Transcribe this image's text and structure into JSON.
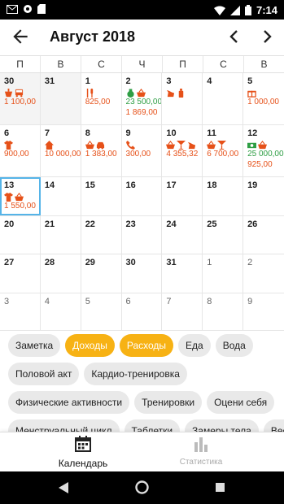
{
  "status": {
    "time": "7:14"
  },
  "toolbar": {
    "title": "Август 2018"
  },
  "weekdays": [
    "П",
    "В",
    "С",
    "Ч",
    "П",
    "С",
    "В"
  ],
  "weeks": [
    [
      {
        "d": "30",
        "out": true,
        "icons": [
          "food-icon",
          "bus-icon"
        ],
        "amounts": [
          {
            "t": "1 100,00",
            "k": "exp"
          }
        ]
      },
      {
        "d": "31",
        "out": true,
        "icons": [],
        "amounts": []
      },
      {
        "d": "1",
        "icons": [
          "restaurant-icon"
        ],
        "amounts": [
          {
            "t": "825,00",
            "k": "exp"
          }
        ]
      },
      {
        "d": "2",
        "icons": [
          "money-bag-icon",
          "basket-icon"
        ],
        "amounts": [
          {
            "t": "23 500,00",
            "k": "inc"
          },
          {
            "t": "1 869,00",
            "k": "exp"
          }
        ]
      },
      {
        "d": "3",
        "icons": [
          "pet-icon",
          "bottle-icon"
        ],
        "amounts": []
      },
      {
        "d": "4",
        "icons": [],
        "amounts": []
      },
      {
        "d": "5",
        "icons": [
          "gift-icon"
        ],
        "amounts": [
          {
            "t": "1 000,00",
            "k": "exp"
          }
        ]
      }
    ],
    [
      {
        "d": "6",
        "icons": [
          "shirt-icon"
        ],
        "amounts": [
          {
            "t": "900,00",
            "k": "exp"
          }
        ]
      },
      {
        "d": "7",
        "icons": [
          "home-icon"
        ],
        "amounts": [
          {
            "t": "10 000,00",
            "k": "exp"
          }
        ]
      },
      {
        "d": "8",
        "icons": [
          "basket-icon",
          "car-icon"
        ],
        "amounts": [
          {
            "t": "1 383,00",
            "k": "exp"
          }
        ]
      },
      {
        "d": "9",
        "icons": [
          "phone-icon"
        ],
        "amounts": [
          {
            "t": "300,00",
            "k": "exp"
          }
        ]
      },
      {
        "d": "10",
        "icons": [
          "basket-icon",
          "cocktail-icon",
          "pet-icon"
        ],
        "amounts": [
          {
            "t": "4 355,32",
            "k": "exp"
          }
        ]
      },
      {
        "d": "11",
        "icons": [
          "basket-icon",
          "cocktail-icon"
        ],
        "amounts": [
          {
            "t": "6 700,00",
            "k": "exp"
          }
        ]
      },
      {
        "d": "12",
        "icons": [
          "cash-icon",
          "basket-icon"
        ],
        "amounts": [
          {
            "t": "25 000,00",
            "k": "inc"
          },
          {
            "t": "925,00",
            "k": "exp"
          }
        ]
      }
    ],
    [
      {
        "d": "13",
        "today": true,
        "icons": [
          "shirt-icon",
          "basket-icon"
        ],
        "amounts": [
          {
            "t": "1 550,00",
            "k": "exp"
          }
        ]
      },
      {
        "d": "14",
        "icons": [],
        "amounts": []
      },
      {
        "d": "15",
        "icons": [],
        "amounts": []
      },
      {
        "d": "16",
        "icons": [],
        "amounts": []
      },
      {
        "d": "17",
        "icons": [],
        "amounts": []
      },
      {
        "d": "18",
        "icons": [],
        "amounts": []
      },
      {
        "d": "19",
        "icons": [],
        "amounts": []
      }
    ],
    [
      {
        "d": "20",
        "icons": [],
        "amounts": []
      },
      {
        "d": "21",
        "icons": [],
        "amounts": []
      },
      {
        "d": "22",
        "icons": [],
        "amounts": []
      },
      {
        "d": "23",
        "icons": [],
        "amounts": []
      },
      {
        "d": "24",
        "icons": [],
        "amounts": []
      },
      {
        "d": "25",
        "icons": [],
        "amounts": []
      },
      {
        "d": "26",
        "icons": [],
        "amounts": []
      }
    ],
    [
      {
        "d": "27",
        "icons": [],
        "amounts": []
      },
      {
        "d": "28",
        "icons": [],
        "amounts": []
      },
      {
        "d": "29",
        "icons": [],
        "amounts": []
      },
      {
        "d": "30",
        "icons": [],
        "amounts": []
      },
      {
        "d": "31",
        "icons": [],
        "amounts": []
      },
      {
        "d": "1",
        "other": true,
        "icons": [],
        "amounts": []
      },
      {
        "d": "2",
        "other": true,
        "icons": [],
        "amounts": []
      }
    ],
    [
      {
        "d": "3",
        "other": true,
        "icons": [],
        "amounts": []
      },
      {
        "d": "4",
        "other": true,
        "icons": [],
        "amounts": []
      },
      {
        "d": "5",
        "other": true,
        "icons": [],
        "amounts": []
      },
      {
        "d": "6",
        "other": true,
        "icons": [],
        "amounts": []
      },
      {
        "d": "7",
        "other": true,
        "icons": [],
        "amounts": []
      },
      {
        "d": "8",
        "other": true,
        "icons": [],
        "amounts": []
      },
      {
        "d": "9",
        "other": true,
        "icons": [],
        "amounts": []
      }
    ]
  ],
  "chips": [
    [
      {
        "label": "Заметка"
      },
      {
        "label": "Доходы",
        "on": true
      },
      {
        "label": "Расходы",
        "on": true
      },
      {
        "label": "Еда"
      },
      {
        "label": "Вода"
      }
    ],
    [
      {
        "label": "Половой акт"
      },
      {
        "label": "Кардио-тренировка"
      }
    ],
    [
      {
        "label": "Физические активности"
      },
      {
        "label": "Тренировки"
      },
      {
        "label": "Оцени себя"
      }
    ],
    [
      {
        "label": "Менструальный цикл"
      },
      {
        "label": "Таблетки"
      },
      {
        "label": "Замеры тела"
      },
      {
        "label": "Вес"
      }
    ]
  ],
  "nav": {
    "calendar": "Календарь",
    "stats": "Статистика"
  },
  "colors": {
    "accent": "#f7b214",
    "expense": "#e65119",
    "income": "#2e9e44",
    "today_border": "#55b4e8"
  }
}
